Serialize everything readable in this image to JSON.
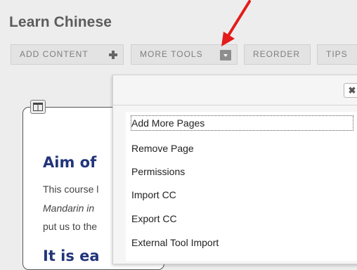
{
  "page": {
    "title": "Learn Chinese"
  },
  "toolbar": {
    "add_content": "ADD CONTENT",
    "more_tools": "MORE TOOLS",
    "reorder": "REORDER",
    "tips": "TIPS"
  },
  "content": {
    "heading": "Aim of",
    "line1": "This course l",
    "line2": "Mandarin in",
    "line3": "put us to the",
    "heading2": "It is ea"
  },
  "menu": {
    "close_label": "✖",
    "items": [
      {
        "label": "Add More Pages"
      },
      {
        "label": "Remove Page"
      },
      {
        "label": "Permissions"
      },
      {
        "label": "Import CC"
      },
      {
        "label": "Export CC"
      },
      {
        "label": "External Tool Import"
      }
    ]
  },
  "icons": {
    "plus": "plus-icon",
    "dropdown": "dropdown-arrow-icon",
    "layout": "layout-icon",
    "close": "close-icon",
    "annotation": "red-arrow-annotation"
  },
  "colors": {
    "annotation_red": "#e31b1b",
    "heading_blue": "#22357a"
  }
}
